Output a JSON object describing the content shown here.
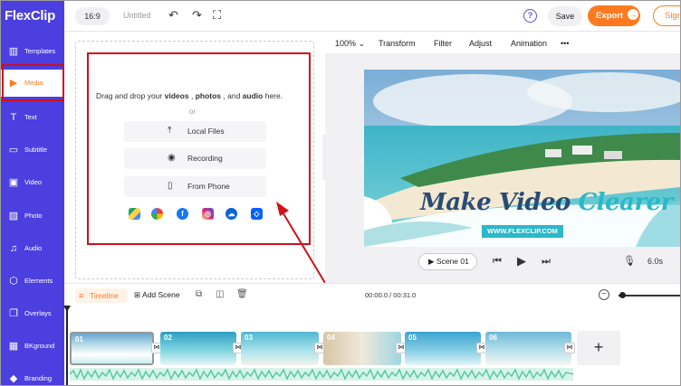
{
  "topbar": {
    "logo_text": "FlexClip",
    "aspect_ratio": "16:9",
    "project_title": "Untitled",
    "save_label": "Save",
    "export_label": "Export",
    "signin_label": "Sign"
  },
  "sidebar": {
    "items": [
      {
        "label": "Templates",
        "icon": "templates-icon"
      },
      {
        "label": "Media",
        "icon": "media-icon"
      },
      {
        "label": "Text",
        "icon": "text-icon"
      },
      {
        "label": "Subtitle",
        "icon": "subtitle-icon"
      },
      {
        "label": "Video",
        "icon": "video-icon"
      },
      {
        "label": "Photo",
        "icon": "photo-icon"
      },
      {
        "label": "Audio",
        "icon": "audio-icon"
      },
      {
        "label": "Elements",
        "icon": "elements-icon"
      },
      {
        "label": "Overlays",
        "icon": "overlays-icon"
      },
      {
        "label": "BKground",
        "icon": "background-icon"
      },
      {
        "label": "Branding",
        "icon": "branding-icon"
      }
    ],
    "active": "Media"
  },
  "media_panel": {
    "drop_prefix": "Drag and drop your",
    "drop_videos": "videos",
    "drop_comma1": ",",
    "drop_photos": "photos",
    "drop_and": ", and",
    "drop_audio": "audio",
    "drop_suffix": "here.",
    "or_text": "or",
    "buttons": {
      "local_files": "Local Files",
      "recording": "Recording",
      "from_phone": "From Phone"
    },
    "cloud_sources": [
      "google-drive-icon",
      "google-photos-icon",
      "facebook-icon",
      "instagram-icon",
      "onedrive-icon",
      "dropbox-icon"
    ]
  },
  "edit_toolbar": {
    "zoom": "100%",
    "transform": "Transform",
    "filter": "Filter",
    "adjust": "Adjust",
    "animation": "Animation",
    "more": "•••"
  },
  "preview": {
    "headline_part1": "Make Video ",
    "headline_part2": "Clearer",
    "url_badge": "WWW.FLEXCLIP.COM",
    "scene_label": "Scene 01",
    "duration": "6.0s"
  },
  "timeline": {
    "tab_label": "Timeline",
    "add_scene_label": "Add Scene",
    "time_readout": "00:00.0 / 00:31.0",
    "clips": [
      "01",
      "02",
      "03",
      "04",
      "05",
      "06"
    ]
  },
  "colors": {
    "brand_purple": "#4b3fe0",
    "accent_orange": "#ff7a1f",
    "annotation_red": "#d0101a",
    "brand_teal": "#2bb8c9"
  }
}
